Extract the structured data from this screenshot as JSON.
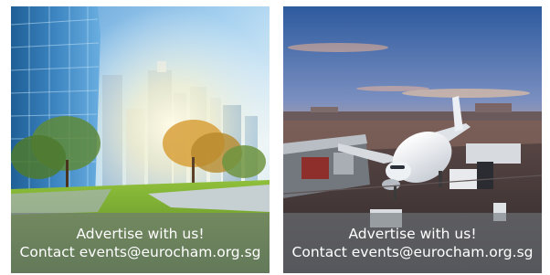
{
  "banners": [
    {
      "scene": "city-skyline-photo",
      "headline": "Advertise with us!",
      "contact": "Contact events@eurocham.org.sg"
    },
    {
      "scene": "airport-airplane-photo",
      "headline": "Advertise with us!",
      "contact": "Contact events@eurocham.org.sg"
    }
  ]
}
